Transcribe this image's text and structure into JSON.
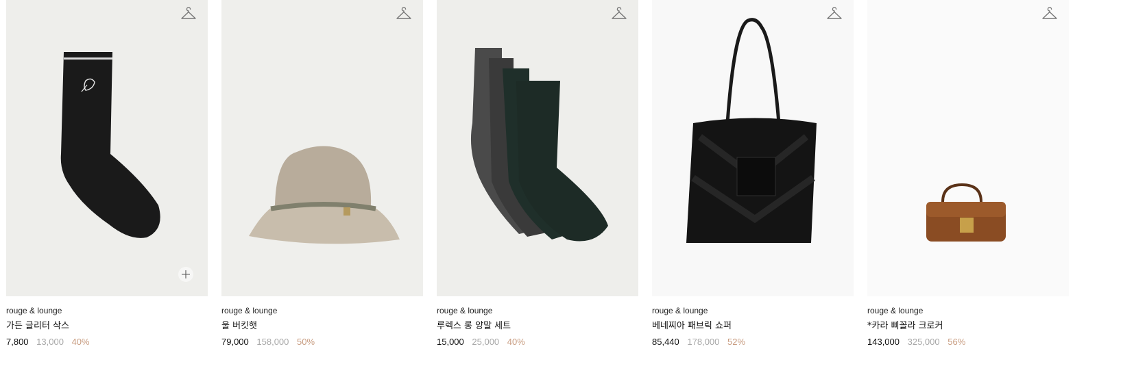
{
  "colors": {
    "discount": "#c89c80",
    "original_price": "#a8a8a8"
  },
  "products": [
    {
      "brand": "rouge & lounge",
      "name": "가든 글리터 삭스",
      "price": "7,800",
      "original_price": "13,000",
      "discount": "40%",
      "bg": "#eeeeeb",
      "icon": "hanger-icon",
      "has_plus": true
    },
    {
      "brand": "rouge & lounge",
      "name": "울 버킷햇",
      "price": "79,000",
      "original_price": "158,000",
      "discount": "50%",
      "bg": "#efefec",
      "icon": "hanger-icon",
      "has_plus": false
    },
    {
      "brand": "rouge & lounge",
      "name": "루렉스 롱 양말 세트",
      "price": "15,000",
      "original_price": "25,000",
      "discount": "40%",
      "bg": "#eeeeeb",
      "icon": "hanger-icon",
      "has_plus": false
    },
    {
      "brand": "rouge & lounge",
      "name": "베네찌아 패브릭 쇼퍼",
      "price": "85,440",
      "original_price": "178,000",
      "discount": "52%",
      "bg": "#f8f8f8",
      "icon": "hanger-icon",
      "has_plus": false
    },
    {
      "brand": "rouge & lounge",
      "name": "*카라 삐꼴라 크로커",
      "price": "143,000",
      "original_price": "325,000",
      "discount": "56%",
      "bg": "#fafafa",
      "icon": "hanger-icon",
      "has_plus": false
    }
  ]
}
